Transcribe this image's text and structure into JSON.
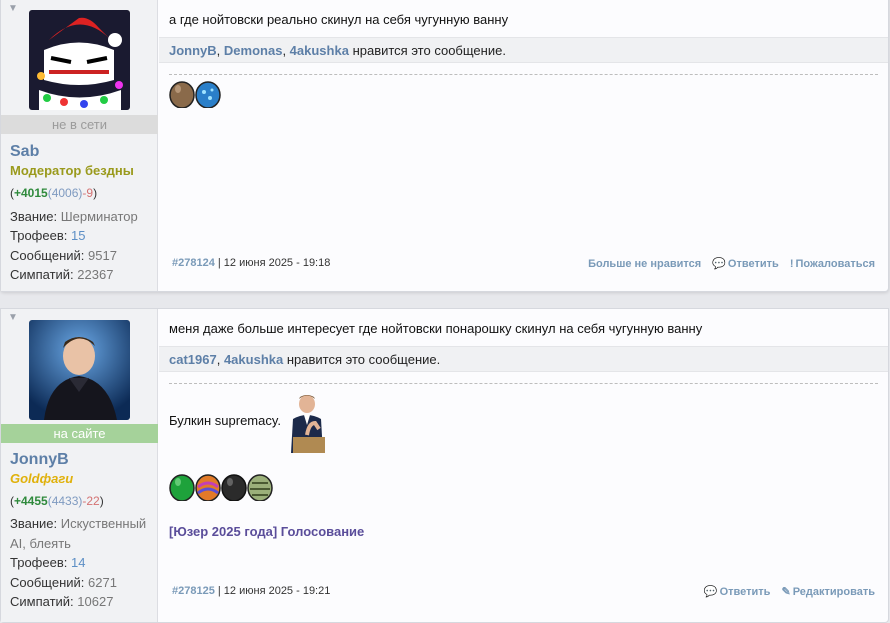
{
  "posts": [
    {
      "arrow": "▼",
      "user": {
        "status": "не в сети",
        "name": "Sab",
        "title": "Модератор бездны",
        "rep_open": "(",
        "rep_total": "+4015",
        "rep_mid": "(4006)",
        "rep_minus": "-9",
        "rep_close": ")",
        "rank_label": "Звание:",
        "rank_value": "Шерминатор",
        "trophies_label": "Трофеев:",
        "trophies_value": "15",
        "messages_label": "Сообщений:",
        "messages_value": "9517",
        "likes_label": "Симпатий:",
        "likes_value": "22367"
      },
      "message": "а где нойтовски реально скинул на себя чугунную ванну",
      "liked_by": [
        "JonnyB",
        "Demonas",
        "4akushka"
      ],
      "liked_suffix": "нравится это сообщение.",
      "post_number": "#278124",
      "date": "| 12 июня 2025 - 19:18",
      "actions": [
        "Больше не нравится",
        "Ответить",
        "Пожаловаться"
      ]
    },
    {
      "arrow": "▼",
      "user": {
        "status": "на сайте",
        "name": "JonnyB",
        "title": "Goldфаги",
        "rep_open": "(",
        "rep_total": "+4455",
        "rep_mid": "(4433)",
        "rep_minus": "-22",
        "rep_close": ")",
        "rank_label": "Звание:",
        "rank_value_1": "Искуственный",
        "rank_value_2": "AI, блеять",
        "trophies_label": "Трофеев:",
        "trophies_value": "14",
        "messages_label": "Сообщений:",
        "messages_value": "6271",
        "likes_label": "Симпатий:",
        "likes_value": "10627"
      },
      "message": "меня даже больше интересует где нойтовски понарошку скинул на себя чугунную ванну",
      "liked_by": [
        "cat1967",
        "4akushka"
      ],
      "liked_suffix": "нравится это сообщение.",
      "signature_text": "Булкин supremacy.",
      "signature_link": "[Юзер 2025 года] Голосование",
      "post_number": "#278125",
      "date": "| 12 июня 2025 - 19:21",
      "actions": [
        "Ответить",
        "Редактировать"
      ]
    }
  ],
  "icons": {
    "unlike": "none",
    "reply": "speech-bubble-icon",
    "report": "exclamation-icon",
    "edit": "pencil-icon"
  },
  "colors": {
    "username": "#5d7fa7",
    "online": "#a5d29a",
    "offline": "#dcdcdc",
    "moderator_title": "#9a9a1c",
    "gold_title": "#e0b10c",
    "rep_plus": "#2f8a3c",
    "rep_minus": "#d47272",
    "sig_link": "#5a4d9a"
  }
}
